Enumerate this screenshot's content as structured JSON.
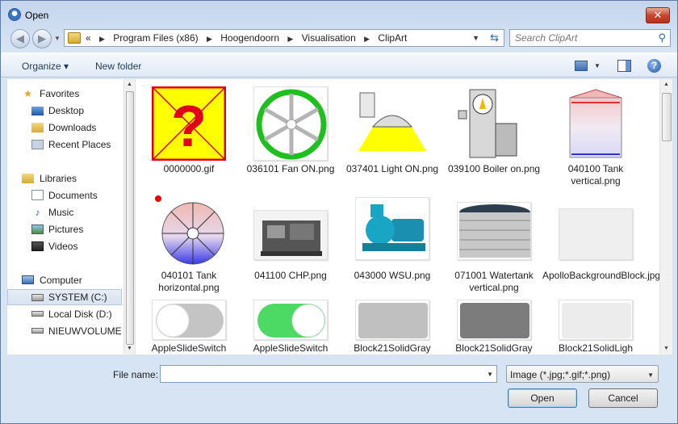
{
  "window": {
    "title": "Open",
    "close_glyph": "✕"
  },
  "address_bar": {
    "overflow": "«",
    "crumbs": [
      "Program Files (x86)",
      "Hoogendoorn",
      "Visualisation",
      "ClipArt"
    ],
    "separator": "▶"
  },
  "search": {
    "placeholder": "Search ClipArt"
  },
  "toolbar": {
    "organize": "Organize ▾",
    "new_folder": "New folder",
    "help_glyph": "?"
  },
  "nav": {
    "favorites": {
      "label": "Favorites",
      "items": [
        "Desktop",
        "Downloads",
        "Recent Places"
      ]
    },
    "libraries": {
      "label": "Libraries",
      "items": [
        "Documents",
        "Music",
        "Pictures",
        "Videos"
      ]
    },
    "computer": {
      "label": "Computer",
      "items": [
        "SYSTEM (C:)",
        "Local Disk (D:)",
        "NIEUWVOLUME (E:)"
      ]
    },
    "selected": "SYSTEM (C:)"
  },
  "files": [
    {
      "name": "0000000.gif"
    },
    {
      "name": "036101 Fan ON.png"
    },
    {
      "name": "037401 Light ON.png"
    },
    {
      "name": "039100 Boiler on.png"
    },
    {
      "name": "040100 Tank vertical.png"
    },
    {
      "name": "040101 Tank horizontal.png"
    },
    {
      "name": "041100 CHP.png"
    },
    {
      "name": "043000 WSU.png"
    },
    {
      "name": "071001 Watertank vertical.png"
    },
    {
      "name": "ApolloBackgroundBlock.jpg"
    },
    {
      "name": "AppleSlideSwitch"
    },
    {
      "name": "AppleSlideSwitch"
    },
    {
      "name": "Block21SolidGray"
    },
    {
      "name": "Block21SolidGray"
    },
    {
      "name": "Block21SolidLigh"
    }
  ],
  "bottom": {
    "file_name_label": "File name:",
    "file_name_value": "",
    "filter": "Image (*.jpg;*.gif;*.png)",
    "open": "Open",
    "cancel": "Cancel"
  },
  "colors": {
    "chrome": "#d7e4f4",
    "selection": "#d6e2f0",
    "fan_green": "#1fbf1f",
    "switch_green": "#4cd964"
  }
}
